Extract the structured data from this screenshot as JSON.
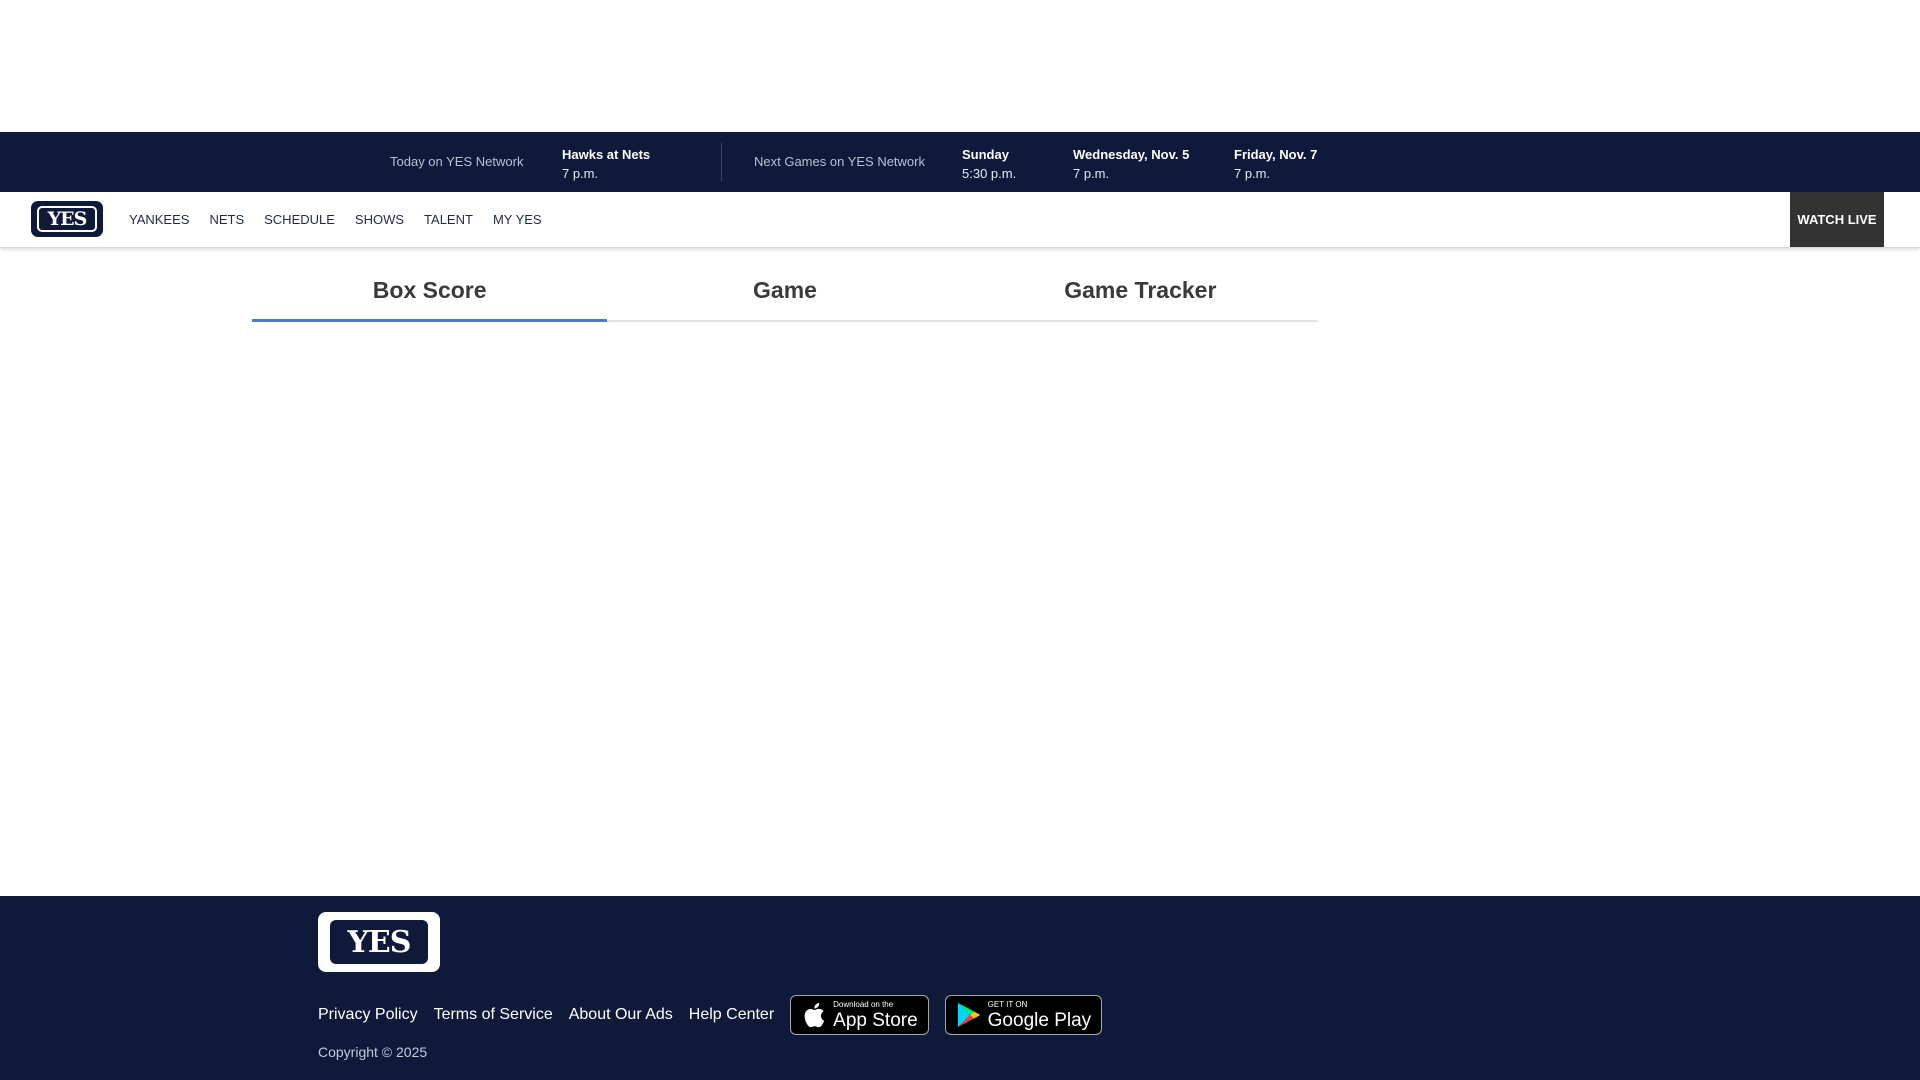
{
  "ticker": {
    "today_label": "Today on YES Network",
    "today_game": {
      "title": "Hawks at Nets",
      "time": "7 p.m."
    },
    "next_label": "Next Games on YES Network",
    "next_games": [
      {
        "day": "Sunday",
        "time": "5:30 p.m."
      },
      {
        "day": "Wednesday, Nov. 5",
        "time": "7 p.m."
      },
      {
        "day": "Friday, Nov. 7",
        "time": "7 p.m."
      }
    ]
  },
  "nav": {
    "logo_text": "YES",
    "items": [
      "YANKEES",
      "NETS",
      "SCHEDULE",
      "SHOWS",
      "TALENT",
      "MY YES"
    ],
    "watch_live": "WATCH LIVE"
  },
  "tabs": [
    {
      "label": "Box Score",
      "active": true
    },
    {
      "label": "Game",
      "active": false
    },
    {
      "label": "Game Tracker",
      "active": false
    }
  ],
  "footer": {
    "logo_text": "YES",
    "links": [
      "Privacy Policy",
      "Terms of Service",
      "About Our Ads",
      "Help Center"
    ],
    "app_store": {
      "small": "Download on the",
      "big": "App Store",
      "icon": "apple-icon"
    },
    "google_play": {
      "small": "GET IT ON",
      "big": "Google Play",
      "icon": "google-play-icon"
    },
    "copyright": "Copyright © 2025"
  },
  "colors": {
    "navy": "#0f1a3a",
    "tab_accent": "#4a7ec8",
    "watch_live_bg": "#333333"
  }
}
